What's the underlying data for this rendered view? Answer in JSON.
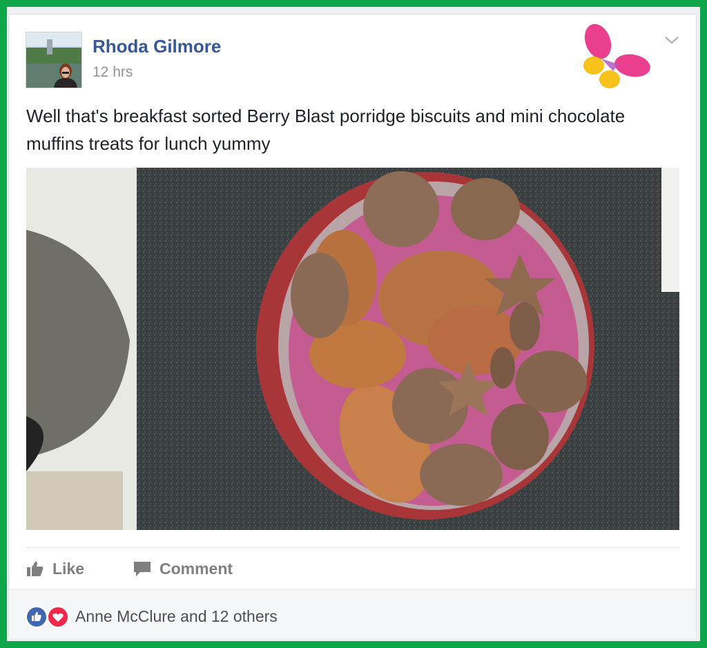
{
  "post": {
    "author": "Rhoda Gilmore",
    "time": "12 hrs",
    "text": "Well that's breakfast sorted Berry Blast porridge biscuits and mini chocolate muffins treats for lunch yummy"
  },
  "actions": {
    "like": "Like",
    "comment": "Comment"
  },
  "reactions": {
    "text": "Anne McClure and 12 others"
  },
  "colors": {
    "frame": "#0ea64a",
    "author_link": "#365899",
    "like_blue": "#4267b2",
    "love_red": "#f0284a"
  },
  "icons": [
    "profile-avatar",
    "butterfly-logo",
    "chevron-down-icon",
    "thumbs-up-icon",
    "comment-icon",
    "like-reaction-icon",
    "love-reaction-icon"
  ]
}
